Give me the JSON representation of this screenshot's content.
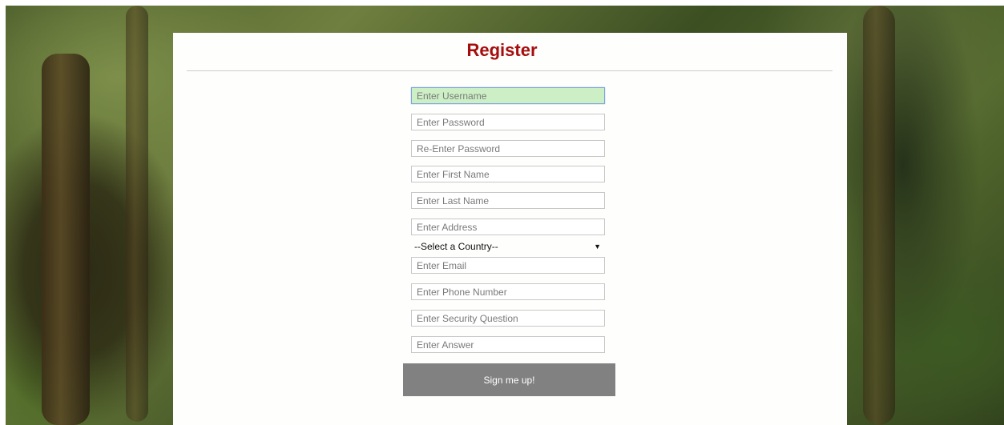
{
  "page": {
    "title": "Register"
  },
  "form": {
    "fields": [
      {
        "name": "username",
        "placeholder": "Enter Username",
        "focused": true
      },
      {
        "name": "password",
        "placeholder": "Enter Password"
      },
      {
        "name": "re-password",
        "placeholder": "Re-Enter Password"
      },
      {
        "name": "first-name",
        "placeholder": "Enter First Name"
      },
      {
        "name": "last-name",
        "placeholder": "Enter Last Name"
      },
      {
        "name": "address",
        "placeholder": "Enter Address"
      },
      {
        "name": "email",
        "placeholder": "Enter Email"
      },
      {
        "name": "phone",
        "placeholder": "Enter Phone Number"
      },
      {
        "name": "security-question",
        "placeholder": "Enter Security Question"
      },
      {
        "name": "answer",
        "placeholder": "Enter Answer"
      }
    ],
    "country_select": {
      "selected": "--Select a Country--",
      "arrow": "▼"
    },
    "submit_label": "Sign me up!"
  },
  "colors": {
    "title": "#a50e0e",
    "focused_field_bg": "#cdefc5",
    "button_bg": "#818181"
  }
}
